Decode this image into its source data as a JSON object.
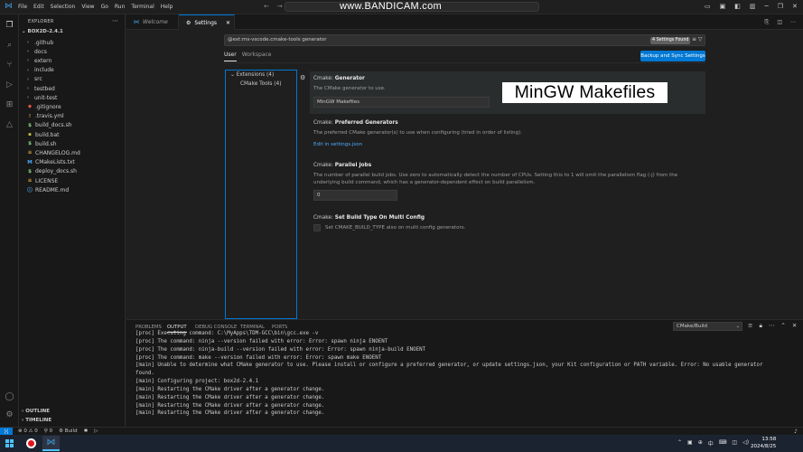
{
  "titlebar": {
    "menu": [
      "File",
      "Edit",
      "Selection",
      "View",
      "Go",
      "Run",
      "Terminal",
      "Help"
    ],
    "watermark": "www.BANDICAM.com"
  },
  "explorer": {
    "header": "EXPLORER",
    "folder": "BOX2D-2.4.1",
    "items": [
      {
        "label": ".github",
        "type": "folder"
      },
      {
        "label": "docs",
        "type": "folder"
      },
      {
        "label": "extern",
        "type": "folder"
      },
      {
        "label": "include",
        "type": "folder"
      },
      {
        "label": "src",
        "type": "folder"
      },
      {
        "label": "testbed",
        "type": "folder"
      },
      {
        "label": "unit-test",
        "type": "folder"
      },
      {
        "label": ".gitignore",
        "type": "file",
        "icon": "◆",
        "color": "#e8534a"
      },
      {
        "label": ".travis.yml",
        "type": "file",
        "icon": "!",
        "color": "#b58f3f"
      },
      {
        "label": "build_docs.sh",
        "type": "file",
        "icon": "$",
        "color": "#89d185"
      },
      {
        "label": "build.bat",
        "type": "file",
        "icon": "▪",
        "color": "#c5c53c"
      },
      {
        "label": "build.sh",
        "type": "file",
        "icon": "$",
        "color": "#89d185"
      },
      {
        "label": "CHANGELOG.md",
        "type": "file",
        "icon": "≡",
        "color": "#d9a441"
      },
      {
        "label": "CMakeLists.txt",
        "type": "file",
        "icon": "M",
        "color": "#4daafc"
      },
      {
        "label": "deploy_docs.sh",
        "type": "file",
        "icon": "$",
        "color": "#89d185"
      },
      {
        "label": "LICENSE",
        "type": "file",
        "icon": "≡",
        "color": "#d9a441"
      },
      {
        "label": "README.md",
        "type": "file",
        "icon": "ⓘ",
        "color": "#4daafc"
      }
    ],
    "outline": "OUTLINE",
    "timeline": "TIMELINE"
  },
  "tabs": {
    "welcome": "Welcome",
    "settings": "Settings"
  },
  "settings": {
    "search_query": "@ext:ms-vscode.cmake-tools generator",
    "found_badge": "4 Settings Found",
    "scope_user": "User",
    "scope_workspace": "Workspace",
    "sync_button": "Backup and Sync Settings",
    "toc_extensions": "Extensions (4)",
    "toc_cmake_tools": "CMake Tools (4)",
    "generator": {
      "category": "Cmake: ",
      "name": "Generator",
      "description": "The CMake generator to use.",
      "value": "MinGW Makefiles"
    },
    "overlay_text": "MinGW Makefiles",
    "preferred": {
      "category": "Cmake: ",
      "name": "Preferred Generators",
      "description": "The preferred CMake generator(s) to use when configuring (tried in order of listing).",
      "link": "Edit in settings.json"
    },
    "parallel": {
      "category": "Cmake: ",
      "name": "Parallel Jobs",
      "description": "The number of parallel build jobs. Use zero to automatically detect the number of CPUs. Setting this to 1 will omit the parallelism flag (-j) from the underlying build command, which has a generator-dependent effect on build parallelism.",
      "value": "0"
    },
    "multi": {
      "category": "Cmake: ",
      "name": "Set Build Type On Multi Config",
      "description": "Set CMAKE_BUILD_TYPE also on multi config generators."
    }
  },
  "panel": {
    "tabs": [
      "PROBLEMS",
      "OUTPUT",
      "DEBUG CONSOLE",
      "TERMINAL",
      "PORTS"
    ],
    "channel": "CMake/Build",
    "log": [
      "[proc] Executing command: C:\\MyApps\\TDM-GCC\\bin\\gcc.exe -v",
      "[proc] The command: ninja --version failed with error: Error: spawn ninja ENOENT",
      "[proc] The command: ninja-build --version failed with error: Error: spawn ninja-build ENOENT",
      "[proc] The command: make --version failed with error: Error: spawn make ENOENT",
      "[main] Unable to determine what CMake generator to use. Please install or configure a preferred generator, or update settings.json, your Kit configuration or PATH variable. Error: No usable generator",
      "found.",
      "[main] Configuring project: box2d-2.4.1",
      "[main] Restarting the CMake driver after a generator change.",
      "[main] Restarting the CMake driver after a generator change.",
      "[main] Restarting the CMake driver after a generator change.",
      "[main] Restarting the CMake driver after a generator change."
    ]
  },
  "statusbar": {
    "errors": "0",
    "warnings": "0",
    "ports": "0",
    "build": "Build"
  },
  "taskbar": {
    "time": "13:58",
    "date": "2024/8/25"
  }
}
